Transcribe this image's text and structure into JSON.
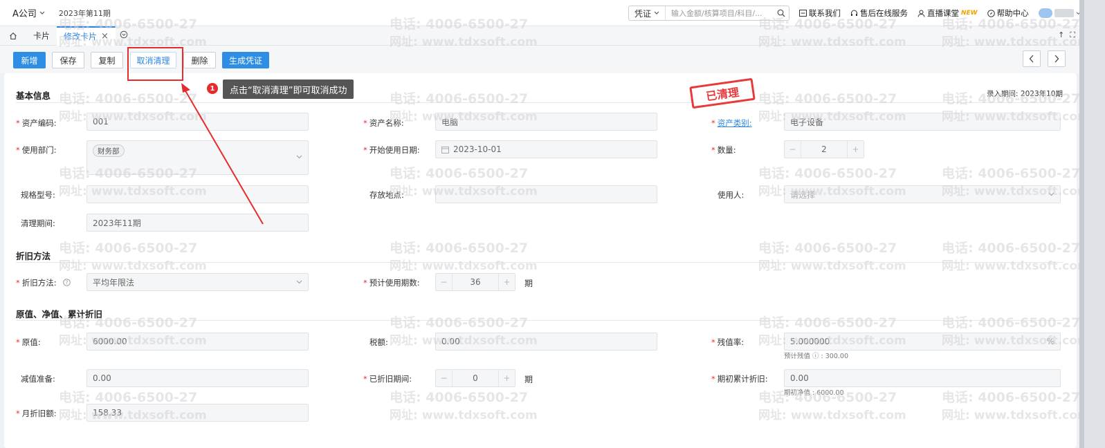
{
  "topbar": {
    "company": "A公司",
    "period": "2023年第11期",
    "voucher_select": "凭证",
    "search_placeholder": "输入金额/核算项目/科目/...",
    "links": {
      "contact": "联系我们",
      "service": "售后在线服务",
      "live": "直播课堂",
      "new_badge": "NEW",
      "help": "帮助中心"
    }
  },
  "tabs": {
    "tab1": "卡片",
    "tab2": "修改卡片",
    "close": "×"
  },
  "toolbar": {
    "new": "新增",
    "save": "保存",
    "copy": "复制",
    "cancel_clear": "取消清理",
    "delete": "删除",
    "gen_voucher": "生成凭证"
  },
  "annotation": {
    "badge": "1",
    "tip": "点击“取消清理”即可取消成功"
  },
  "stamp": "已清理",
  "basic": {
    "section": "基本信息",
    "entry_period": "录入期间: 2023年10期",
    "asset_code_label": "资产编码:",
    "asset_code": "001",
    "asset_name_label": "资产名称:",
    "asset_name": "电脑",
    "asset_type_label": "资产类别:",
    "asset_type": "电子设备",
    "dept_label": "使用部门:",
    "dept_tag": "财务部",
    "start_date_label": "开始使用日期:",
    "start_date": "2023-10-01",
    "qty_label": "数量:",
    "qty": "2",
    "spec_label": "规格型号:",
    "location_label": "存放地点:",
    "user_label": "使用人:",
    "user_placeholder": "请选择",
    "clear_period_label": "清理期间:",
    "clear_period": "2023年11期"
  },
  "depr": {
    "section": "折旧方法",
    "method_label": "折旧方法:",
    "method": "平均年限法",
    "periods_label": "预计使用期数:",
    "periods": "36",
    "unit": "期"
  },
  "value": {
    "section": "原值、净值、累计折旧",
    "orig_label": "原值:",
    "orig": "6000.00",
    "tax_label": "税额:",
    "tax": "0.00",
    "residual_label": "残值率:",
    "residual": "5.000000",
    "residual_unit": "%",
    "residual_hint": "预计残值 ⓘ : 300.00",
    "impair_label": "减值准备:",
    "impair": "0.00",
    "depr_periods_label": "已折旧期间:",
    "depr_periods": "0",
    "unit": "期",
    "accum_label": "期初累计折旧:",
    "accum": "0.00",
    "net_hint": "期初净值 : 6000.00",
    "monthly_label": "月折旧额:",
    "monthly": "158.33"
  },
  "watermark": {
    "phone": "电话: 4006-6500-27",
    "url": "网址: www.tdxsoft.com"
  }
}
